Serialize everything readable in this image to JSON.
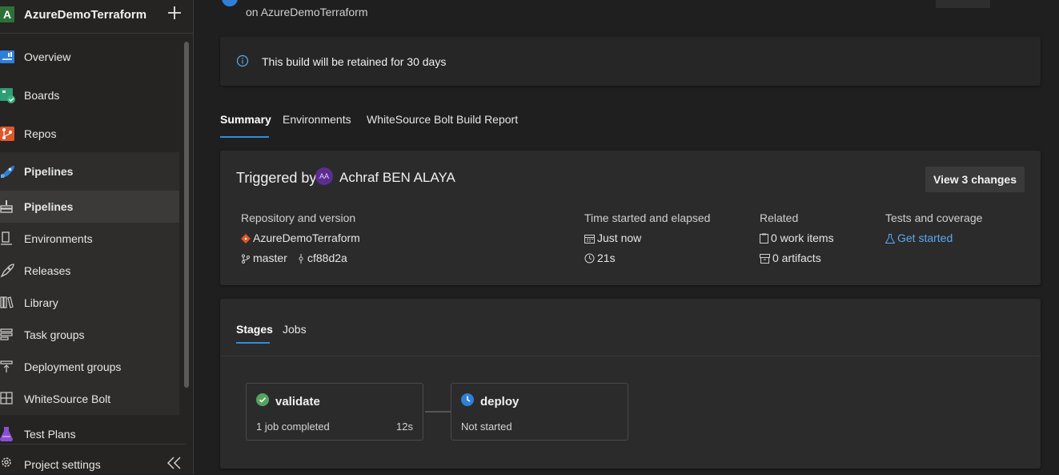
{
  "sidebar": {
    "org_badge": "A",
    "org_name": "AzureDemoTerraform",
    "items": [
      {
        "label": "Overview",
        "icon": "overview-icon"
      },
      {
        "label": "Boards",
        "icon": "boards-icon"
      },
      {
        "label": "Repos",
        "icon": "repos-icon"
      },
      {
        "label": "Pipelines",
        "icon": "pipelines-icon"
      },
      {
        "label": "Pipelines",
        "icon": "pipelines-sub-icon"
      },
      {
        "label": "Environments",
        "icon": "environments-icon"
      },
      {
        "label": "Releases",
        "icon": "releases-icon"
      },
      {
        "label": "Library",
        "icon": "library-icon"
      },
      {
        "label": "Task groups",
        "icon": "task-groups-icon"
      },
      {
        "label": "Deployment groups",
        "icon": "deployment-groups-icon"
      },
      {
        "label": "WhiteSource Bolt",
        "icon": "whitesource-icon"
      },
      {
        "label": "Test Plans",
        "icon": "test-plans-icon"
      }
    ],
    "project_settings": "Project settings"
  },
  "header": {
    "subtitle": "on AzureDemoTerraform"
  },
  "banner": {
    "text": "This build will be retained for 30 days"
  },
  "tabs": [
    {
      "label": "Summary",
      "active": true
    },
    {
      "label": "Environments",
      "active": false
    },
    {
      "label": "WhiteSource Bolt Build Report",
      "active": false
    }
  ],
  "summary": {
    "triggered_label": "Triggered by",
    "avatar_initials": "AA",
    "triggered_by": "Achraf BEN ALAYA",
    "view_changes": "View 3 changes",
    "repository": {
      "heading": "Repository and version",
      "repo": "AzureDemoTerraform",
      "branch": "master",
      "commit": "cf88d2a"
    },
    "time": {
      "heading": "Time started and elapsed",
      "started": "Just now",
      "elapsed": "21s"
    },
    "related": {
      "heading": "Related",
      "work_items": "0 work items",
      "artifacts": "0 artifacts"
    },
    "tests": {
      "heading": "Tests and coverage",
      "link": "Get started"
    }
  },
  "stages_card": {
    "tabs": [
      {
        "label": "Stages",
        "active": true
      },
      {
        "label": "Jobs",
        "active": false
      }
    ],
    "stages": [
      {
        "name": "validate",
        "status": "1 job completed",
        "duration": "12s",
        "state": "succeeded"
      },
      {
        "name": "deploy",
        "status": "Not started",
        "duration": "",
        "state": "pending"
      }
    ]
  },
  "colors": {
    "accent": "#2f8ddb",
    "success": "#55a362",
    "link": "#5ea8f0"
  }
}
